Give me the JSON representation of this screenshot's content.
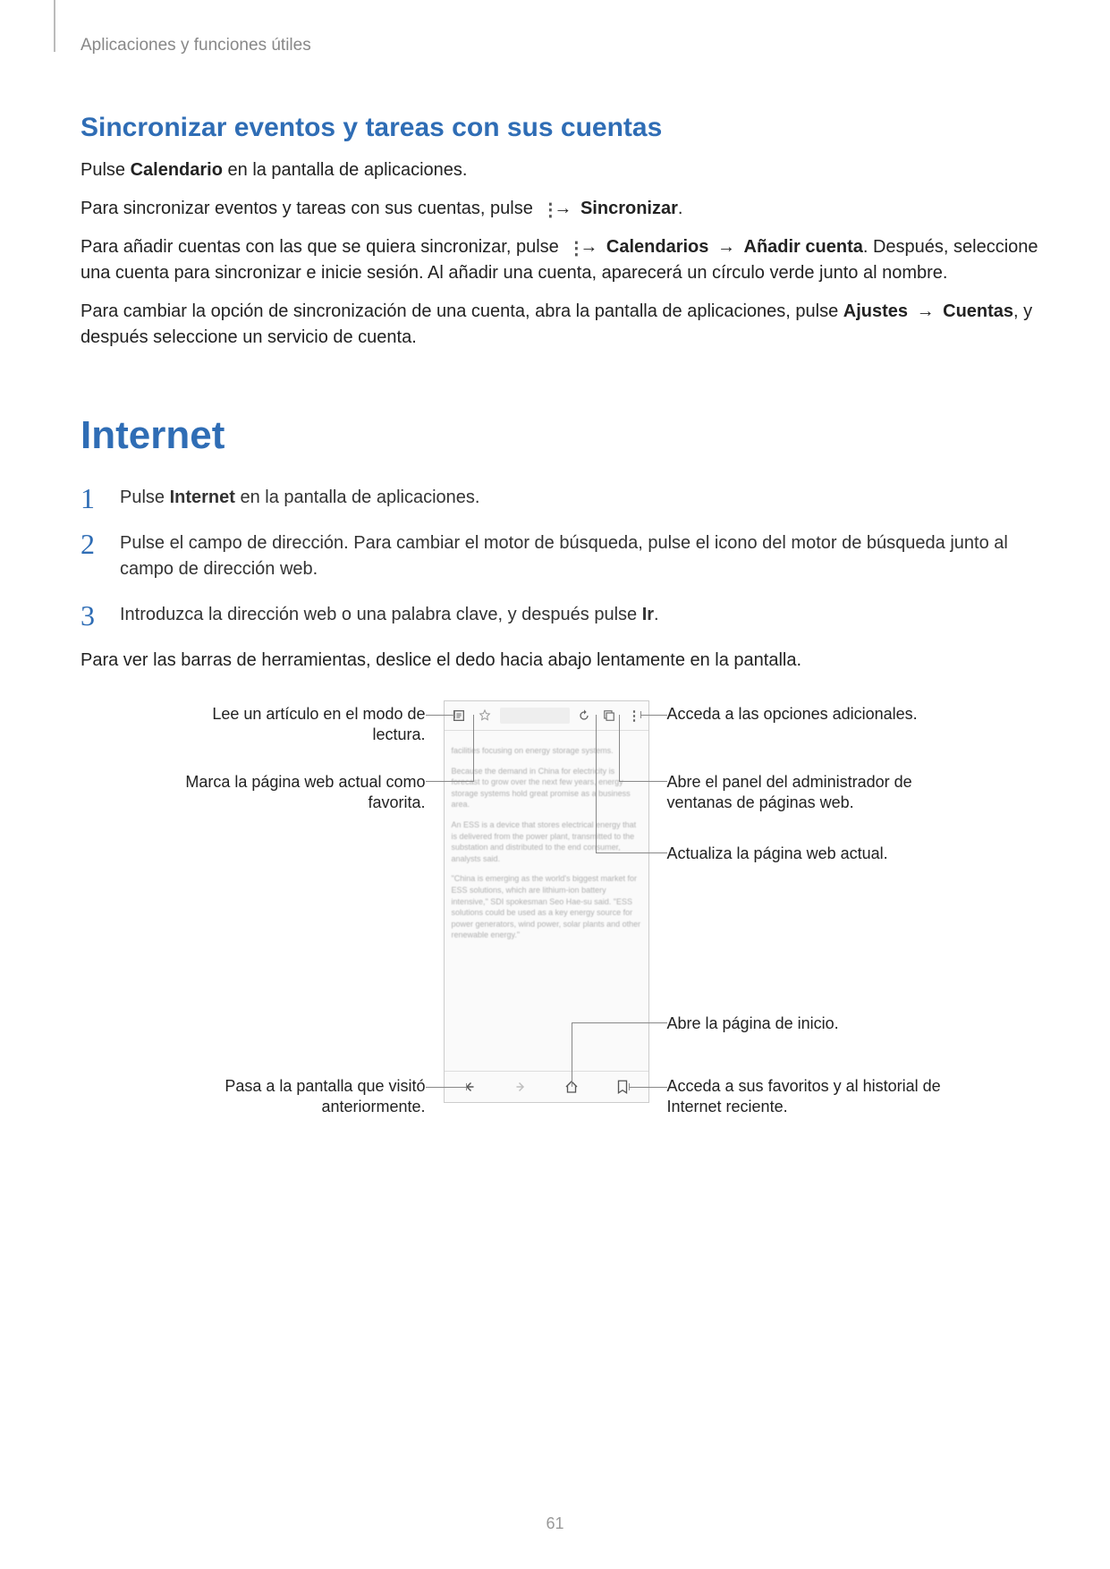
{
  "header": {
    "breadcrumb": "Aplicaciones y funciones útiles"
  },
  "section1": {
    "heading": "Sincronizar eventos y tareas con sus cuentas",
    "p1_before": "Pulse ",
    "p1_bold": "Calendario",
    "p1_after": " en la pantalla de aplicaciones.",
    "p2_before": "Para sincronizar eventos y tareas con sus cuentas, pulse ",
    "p2_arrow": "→",
    "p2_bold": "Sincronizar",
    "p2_end": ".",
    "p3_before": "Para añadir cuentas con las que se quiera sincronizar, pulse ",
    "p3_arrow1": "→",
    "p3_bold1": "Calendarios",
    "p3_arrow2": "→",
    "p3_bold2": "Añadir cuenta",
    "p3_after": ". Después, seleccione una cuenta para sincronizar e inicie sesión. Al añadir una cuenta, aparecerá un círculo verde junto al nombre.",
    "p4_before": "Para cambiar la opción de sincronización de una cuenta, abra la pantalla de aplicaciones, pulse ",
    "p4_bold1": "Ajustes",
    "p4_arrow": "→",
    "p4_bold2": "Cuentas",
    "p4_after": ", y después seleccione un servicio de cuenta."
  },
  "section2": {
    "heading": "Internet",
    "steps": [
      {
        "num": "1",
        "before": "Pulse ",
        "bold": "Internet",
        "after": " en la pantalla de aplicaciones."
      },
      {
        "num": "2",
        "text": "Pulse el campo de dirección. Para cambiar el motor de búsqueda, pulse el icono del motor de búsqueda junto al campo de dirección web."
      },
      {
        "num": "3",
        "before": "Introduzca la dirección web o una palabra clave, y después pulse ",
        "bold": "Ir",
        "after": "."
      }
    ],
    "after_steps": "Para ver las barras de herramientas, deslice el dedo hacia abajo lentamente en la pantalla."
  },
  "callouts": {
    "left1": "Lee un artículo en el modo de lectura.",
    "left2": "Marca la página web actual como favorita.",
    "left3": "Pasa a la pantalla que visitó anteriormente.",
    "right1": "Acceda a las opciones adicionales.",
    "right2": "Abre el panel del administrador de ventanas de páginas web.",
    "right3": "Actualiza la página web actual.",
    "right4": "Abre la página de inicio.",
    "right5": "Acceda a sus favoritos y al historial de Internet reciente."
  },
  "page_number": "61"
}
